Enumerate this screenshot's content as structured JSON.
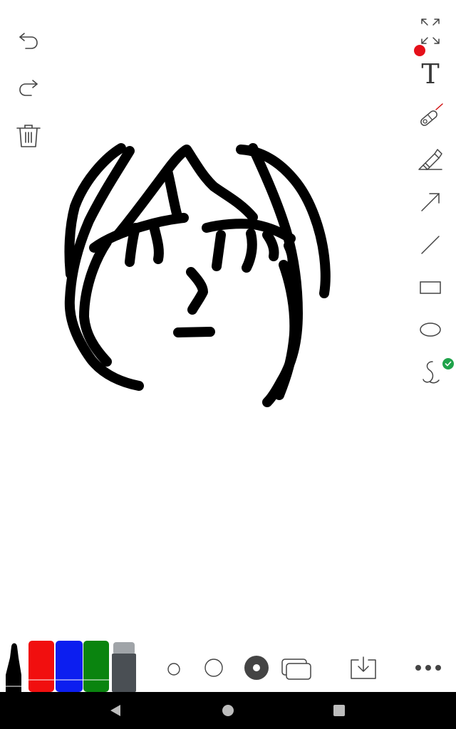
{
  "canvas": {
    "ink_color": "#000000",
    "stroke_width_px": 14
  },
  "left_tools": {
    "undo": "undo-icon",
    "redo": "redo-icon",
    "clear": "trash-icon"
  },
  "right_tools": {
    "fullscreen": "fullscreen-icon",
    "text_tool_label": "T",
    "laser_pointer": "laser-pointer-icon",
    "highlighter": "highlighter-icon",
    "arrow": "arrow-icon",
    "line": "line-icon",
    "rectangle": "rectangle-icon",
    "ellipse": "ellipse-icon",
    "freehand": "freehand-icon",
    "recording_dot_color": "#e5101a",
    "active_check_color": "#1fa34a"
  },
  "palette": {
    "markers": [
      {
        "name": "black",
        "color": "#000000",
        "selected": true
      },
      {
        "name": "red",
        "color": "#f10f0f",
        "selected": false
      },
      {
        "name": "blue",
        "color": "#0c1ef0",
        "selected": false
      },
      {
        "name": "green",
        "color": "#0a840f",
        "selected": false
      },
      {
        "name": "eraser",
        "color": "#4a4f54",
        "selected": false
      }
    ]
  },
  "sizes": {
    "options": [
      "small",
      "medium",
      "large"
    ],
    "selected": "large"
  },
  "actions": {
    "pages": "pages-icon",
    "save": "download-icon",
    "more": "more-icon"
  },
  "nav": {
    "back": "back-icon",
    "home": "home-icon",
    "recents": "recents-icon"
  }
}
